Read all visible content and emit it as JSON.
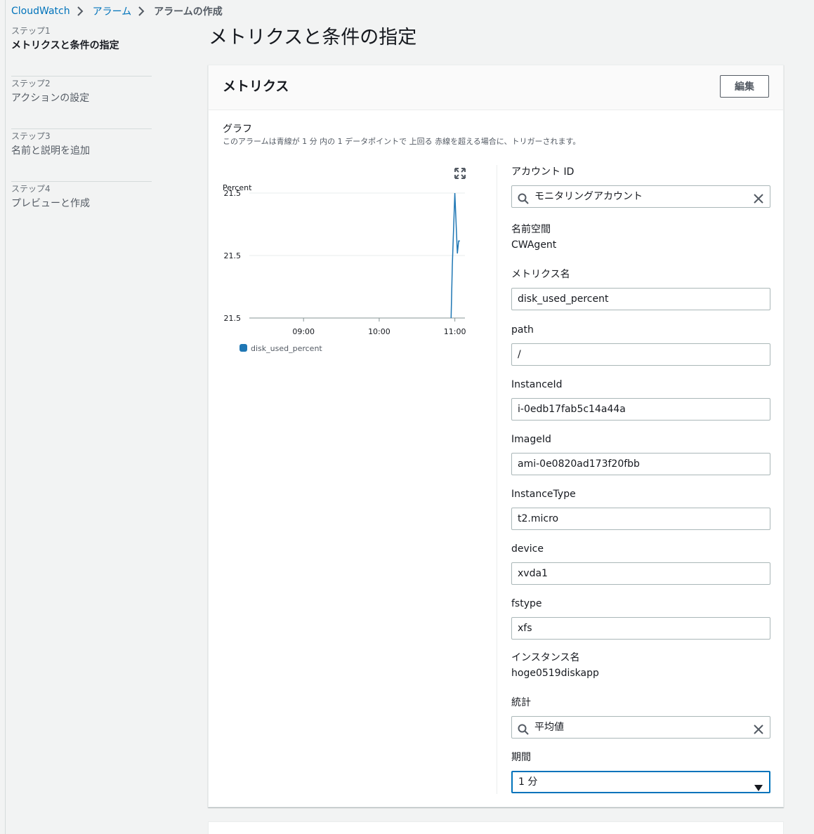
{
  "breadcrumb": {
    "items": [
      "CloudWatch",
      "アラーム"
    ],
    "current": "アラームの作成"
  },
  "steps": [
    {
      "label": "ステップ1",
      "name": "メトリクスと条件の指定",
      "active": true
    },
    {
      "label": "ステップ2",
      "name": "アクションの設定",
      "active": false
    },
    {
      "label": "ステップ3",
      "name": "名前と説明を追加",
      "active": false
    },
    {
      "label": "ステップ4",
      "name": "プレビューと作成",
      "active": false
    }
  ],
  "page": {
    "title": "メトリクスと条件の指定"
  },
  "metrics_panel": {
    "title": "メトリクス",
    "edit_label": "編集",
    "graph_title": "グラフ",
    "graph_description": "このアラームは青線が 1 分 内の 1 データポイントで 上回る 赤線を超える場合に、トリガーされます。"
  },
  "chart_data": {
    "type": "line",
    "ylabel": "Percent",
    "y_ticks": [
      "21.5",
      "21.5",
      "21.5"
    ],
    "x_ticks": [
      "09:00",
      "10:00",
      "11:00"
    ],
    "series": [
      {
        "name": "disk_used_percent",
        "color": "#1f77b4",
        "points": [
          [
            "10:57",
            21.5
          ],
          [
            "10:58",
            21.525
          ],
          [
            "11:00",
            21.56
          ],
          [
            "11:02",
            21.531
          ],
          [
            "11:03",
            21.537
          ],
          [
            "11:04",
            21.537
          ]
        ]
      }
    ]
  },
  "form": {
    "account": {
      "label": "アカウント ID",
      "value": "モニタリングアカウント"
    },
    "namespace": {
      "label": "名前空間",
      "value": "CWAgent"
    },
    "metric_name": {
      "label": "メトリクス名",
      "value": "disk_used_percent"
    },
    "path": {
      "label": "path",
      "value": "/"
    },
    "instance_id": {
      "label": "InstanceId",
      "value": "i-0edb17fab5c14a44a"
    },
    "image_id": {
      "label": "ImageId",
      "value": "ami-0e0820ad173f20fbb"
    },
    "instance_type": {
      "label": "InstanceType",
      "value": "t2.micro"
    },
    "device": {
      "label": "device",
      "value": "xvda1"
    },
    "fstype": {
      "label": "fstype",
      "value": "xfs"
    },
    "instance_name": {
      "label": "インスタンス名",
      "value": "hoge0519diskapp"
    },
    "statistic": {
      "label": "統計",
      "value": "平均値"
    },
    "period": {
      "label": "期間",
      "value": "1 分"
    }
  },
  "colors": {
    "link": "#0073bb",
    "series": "#1f77b4",
    "focus": "#0073bb"
  }
}
